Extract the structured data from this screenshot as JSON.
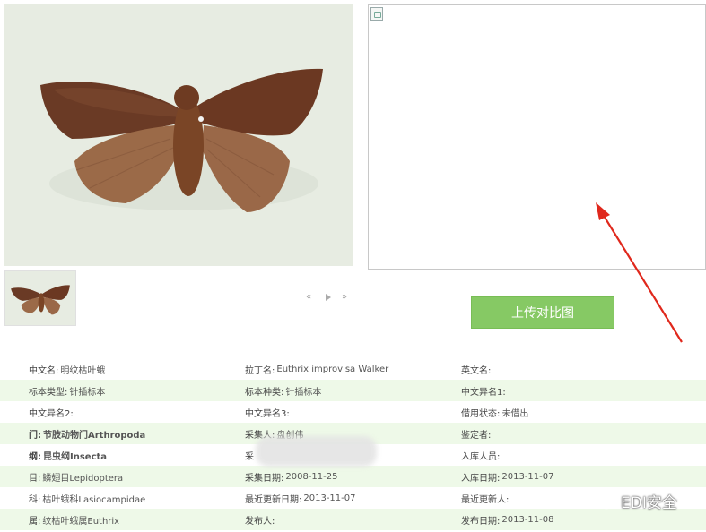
{
  "upload_button": {
    "label": "上传对比图"
  },
  "pager": {
    "prev": "«",
    "next": "»"
  },
  "colors": {
    "accent": "#86c964",
    "row_alt": "#eef9e8",
    "arrow": "#e0281c"
  },
  "rows": [
    [
      {
        "label": "中文名:",
        "value": "明纹枯叶蛾",
        "bold": false
      },
      {
        "label": "拉丁名:",
        "value": "Euthrix improvisa Walker",
        "bold": false
      },
      {
        "label": "英文名:",
        "value": "",
        "bold": false
      }
    ],
    [
      {
        "label": "标本类型:",
        "value": "针插标本",
        "bold": false
      },
      {
        "label": "标本种类:",
        "value": "针插标本",
        "bold": false
      },
      {
        "label": "中文异名1:",
        "value": "",
        "bold": false
      }
    ],
    [
      {
        "label": "中文异名2:",
        "value": "",
        "bold": false
      },
      {
        "label": "中文异名3:",
        "value": "",
        "bold": false
      },
      {
        "label": "借用状态:",
        "value": "未借出",
        "bold": false
      }
    ],
    [
      {
        "label": "门:",
        "value": "节肢动物门Arthropoda",
        "bold": true
      },
      {
        "label": "采集人:",
        "value": "盘创伟",
        "bold": false
      },
      {
        "label": "鉴定者:",
        "value": "",
        "bold": false
      }
    ],
    [
      {
        "label": "纲:",
        "value": "昆虫纲Insecta",
        "bold": true
      },
      {
        "label": "采",
        "value": "",
        "bold": false
      },
      {
        "label": "入库人员:",
        "value": "",
        "bold": false
      }
    ],
    [
      {
        "label": "目:",
        "value": "鳞翅目Lepidoptera",
        "bold": false
      },
      {
        "label": "采集日期:",
        "value": "2008-11-25",
        "bold": false
      },
      {
        "label": "入库日期:",
        "value": "2013-11-07",
        "bold": false
      }
    ],
    [
      {
        "label": "科:",
        "value": "枯叶蛾科Lasiocampidae",
        "bold": false
      },
      {
        "label": "最近更新日期:",
        "value": "2013-11-07",
        "bold": false
      },
      {
        "label": "最近更新人:",
        "value": "",
        "bold": false
      }
    ],
    [
      {
        "label": "属:",
        "value": "纹枯叶蛾属Euthrix",
        "bold": false
      },
      {
        "label": "发布人:",
        "value": "",
        "bold": false
      },
      {
        "label": "发布日期:",
        "value": "2013-11-08",
        "bold": false
      }
    ]
  ],
  "watermark": {
    "text": "EDI安全",
    "icon": "wechat-icon"
  }
}
